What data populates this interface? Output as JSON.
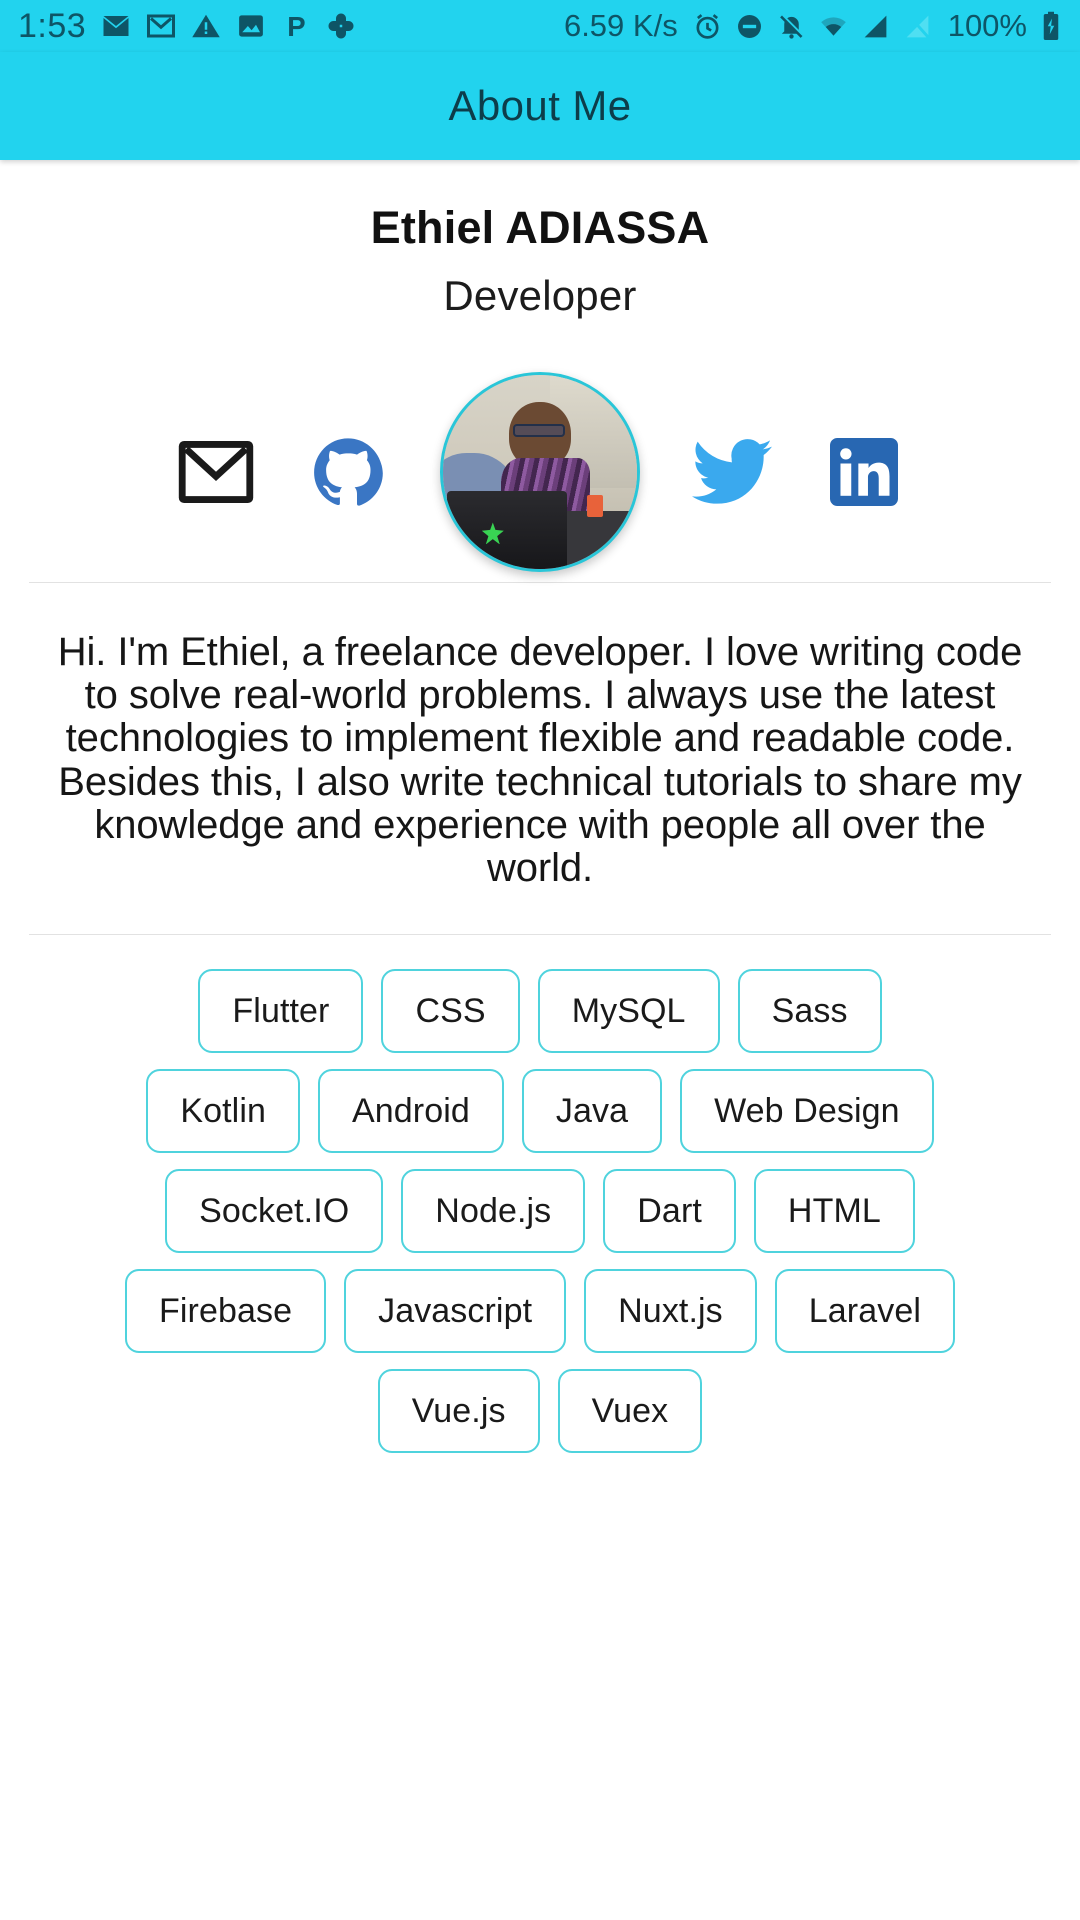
{
  "status_bar": {
    "time": "1:53",
    "network_speed": "6.59 K/s",
    "battery_percent": "100%",
    "left_icons": [
      "mail-icon",
      "gmail-icon",
      "warning-icon",
      "photos-icon",
      "pinterest-icon",
      "google-photos-icon"
    ],
    "right_icons": [
      "alarm-icon",
      "do-not-disturb-icon",
      "bell-muted-icon",
      "wifi-icon",
      "cellular-signal-icon",
      "cellular-signal-off-icon",
      "battery-icon"
    ],
    "background_color": "#22D3EE",
    "foreground_color": "#0e5566"
  },
  "app_bar": {
    "title": "About Me",
    "background_color": "#22D3EE",
    "title_color": "#0d3d4a"
  },
  "profile": {
    "name": "Ethiel ADIASSA",
    "role": "Developer",
    "avatar_alt": "profile-photo",
    "avatar_ring_color": "#29c6d8"
  },
  "social_links": [
    {
      "name": "email-icon",
      "label": "Email",
      "color": "#1a1a1a"
    },
    {
      "name": "github-icon",
      "label": "GitHub",
      "color": "#3a76c4"
    },
    {
      "name": "twitter-icon",
      "label": "Twitter",
      "color": "#3aa9ee"
    },
    {
      "name": "linkedin-icon",
      "label": "LinkedIn",
      "color": "#2867B2"
    }
  ],
  "bio": {
    "text": "Hi. I'm Ethiel, a freelance developer. I love writing code to solve real-world problems. I always use the latest technologies to implement flexible and readable code. Besides this, I also write technical tutorials to share my knowledge and experience with people all over the world."
  },
  "skills": {
    "accent_color": "#4fd3dd",
    "rows": [
      [
        "Flutter",
        "CSS",
        "MySQL",
        "Sass"
      ],
      [
        "Kotlin",
        "Android",
        "Java",
        "Web Design"
      ],
      [
        "Socket.IO",
        "Node.js",
        "Dart",
        "HTML"
      ],
      [
        "Firebase",
        "Javascript",
        "Nuxt.js",
        "Laravel"
      ],
      [
        "Vue.js",
        "Vuex"
      ]
    ]
  }
}
